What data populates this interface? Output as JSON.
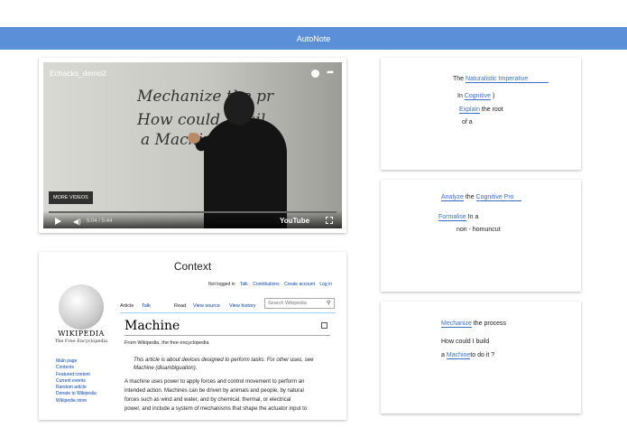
{
  "app": {
    "title": "AutoNote",
    "accent": "#5b8fd8"
  },
  "video": {
    "title": "Echacks_demo2",
    "more_videos": "MORE VIDEOS",
    "time": "5:04 / 5:44",
    "brand": "YouTube",
    "board_lines": [
      "Mechanize the pr",
      "How could I buil",
      "a Machine"
    ]
  },
  "context": {
    "title": "Context",
    "top_links": [
      "Not logged in",
      "Talk",
      "Contributions",
      "Create account",
      "Log in"
    ],
    "wordmark": "WIKIPEDIA",
    "tagline": "The Free Encyclopedia",
    "side_links": [
      "Main page",
      "Contents",
      "Featured content",
      "Current events",
      "Random article",
      "Donate to Wikipedia",
      "Wikipedia store"
    ],
    "tabs": [
      "Article",
      "Talk",
      "Read",
      "View source",
      "View history"
    ],
    "search_placeholder": "Search Wikipedia",
    "heading": "Machine",
    "from": "From Wikipedia, the free encyclopedia",
    "hatnote": "This article is about devices designed to perform tasks. For other uses, see Machine (disambiguation).",
    "body_lines": [
      "A machine uses power to apply forces and control movement to perform an",
      "intended action. Machines can be driven by animals and people, by natural",
      "forces such as wind and water, and by chemical, thermal, or electrical",
      "power, and include a system of mechanisms that shape the actuator input to"
    ]
  },
  "notes": [
    {
      "lines": [
        {
          "pre": "The",
          "fill": "Naturalistic Imperative",
          "post": ""
        },
        {
          "pre": "In",
          "fill": "Cognitive",
          "post": ")"
        },
        {
          "pre": "",
          "fill": "Explain",
          "post": "the root"
        },
        {
          "pre": "of a",
          "fill": "",
          "post": ""
        }
      ]
    },
    {
      "lines": [
        {
          "pre": "",
          "fill": "Analyze",
          "post": "the",
          "fill2": "Cognitive Pro"
        },
        {
          "pre": "",
          "fill": "Formalise",
          "post": "In a"
        },
        {
          "pre": "non - homuncut",
          "fill": "",
          "post": ""
        }
      ]
    },
    {
      "lines": [
        {
          "pre": "",
          "fill": "Mechanize",
          "post": "the process"
        },
        {
          "pre": "How could I build",
          "fill": "",
          "post": ""
        },
        {
          "pre": "a",
          "fill": "Machine",
          "post": "to do it ?"
        }
      ]
    }
  ]
}
